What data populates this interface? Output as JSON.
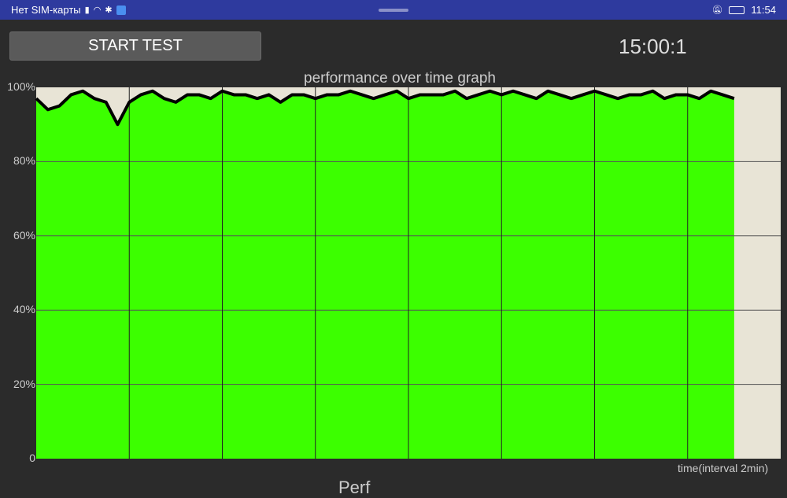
{
  "status_bar": {
    "carrier": "Нет SIM-карты",
    "time": "11:54",
    "icons": [
      "sim-alert-icon",
      "wifi-icon",
      "gear-icon",
      "app-store-icon",
      "bell-off-icon",
      "battery-icon"
    ]
  },
  "toolbar": {
    "start_label": "START TEST",
    "timer": "15:00:1"
  },
  "footer": {
    "partial_text": "Perf"
  },
  "colors": {
    "fill": "#3cff00",
    "line": "#000000",
    "bg_plot": "#e8e4d6",
    "status": "#2e3a9e"
  },
  "chart_data": {
    "type": "area",
    "title": "performance over time graph",
    "xlabel": "time(interval 2min)",
    "ylabel": "",
    "xlim": [
      0,
      16
    ],
    "ylim": [
      0,
      100
    ],
    "y_ticks": [
      "0",
      "20%",
      "40%",
      "60%",
      "80%",
      "100%"
    ],
    "x_step": 0.25,
    "values": [
      97,
      94,
      95,
      98,
      99,
      97,
      96,
      90,
      96,
      98,
      99,
      97,
      96,
      98,
      98,
      97,
      99,
      98,
      98,
      97,
      98,
      96,
      98,
      98,
      97,
      98,
      98,
      99,
      98,
      97,
      98,
      99,
      97,
      98,
      98,
      98,
      99,
      97,
      98,
      99,
      98,
      99,
      98,
      97,
      99,
      98,
      97,
      98,
      99,
      98,
      97,
      98,
      98,
      99,
      97,
      98,
      98,
      97,
      99,
      98,
      97
    ]
  }
}
